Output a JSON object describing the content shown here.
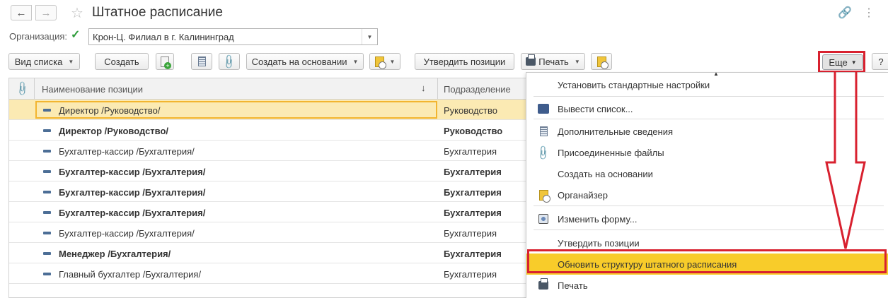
{
  "window": {
    "title": "Штатное расписание"
  },
  "org": {
    "label": "Организация:",
    "value": "Крон-Ц. Филиал в г. Калининград"
  },
  "toolbar": {
    "view_list": "Вид списка",
    "create": "Создать",
    "create_based": "Создать на основании",
    "approve": "Утвердить позиции",
    "print": "Печать",
    "more": "Еще",
    "help": "?"
  },
  "table": {
    "col_name": "Наименование позиции",
    "col_dept": "Подразделение",
    "rows": [
      {
        "name": "Директор /Руководство/",
        "dept": "Руководство",
        "bold": false,
        "selected": true
      },
      {
        "name": "Директор /Руководство/",
        "dept": "Руководство",
        "bold": true,
        "selected": false
      },
      {
        "name": "Бухгалтер-кассир /Бухгалтерия/",
        "dept": "Бухгалтерия",
        "bold": false,
        "selected": false
      },
      {
        "name": "Бухгалтер-кассир /Бухгалтерия/",
        "dept": "Бухгалтерия",
        "bold": true,
        "selected": false
      },
      {
        "name": "Бухгалтер-кассир /Бухгалтерия/",
        "dept": "Бухгалтерия",
        "bold": true,
        "selected": false
      },
      {
        "name": "Бухгалтер-кассир /Бухгалтерия/",
        "dept": "Бухгалтерия",
        "bold": true,
        "selected": false
      },
      {
        "name": "Бухгалтер-кассир /Бухгалтерия/",
        "dept": "Бухгалтерия",
        "bold": false,
        "selected": false
      },
      {
        "name": "Менеджер /Бухгалтерия/",
        "dept": "Бухгалтерия",
        "bold": true,
        "selected": false
      },
      {
        "name": "Главный бухгалтер /Бухгалтерия/",
        "dept": "Бухгалтерия",
        "bold": false,
        "selected": false
      }
    ]
  },
  "menu": {
    "items": [
      {
        "label": "Установить стандартные настройки",
        "icon": "none"
      },
      {
        "label": "Вывести список...",
        "icon": "export-icon"
      },
      {
        "label": "Дополнительные сведения",
        "icon": "list-icon"
      },
      {
        "label": "Присоединенные файлы",
        "icon": "paperclip-icon"
      },
      {
        "label": "Создать на основании",
        "icon": "none"
      },
      {
        "label": "Органайзер",
        "icon": "organizer-icon"
      },
      {
        "label": "Изменить форму...",
        "icon": "form-icon"
      },
      {
        "label": "Утвердить позиции",
        "icon": "none"
      },
      {
        "label": "Обновить структуру штатного расписания",
        "icon": "none",
        "highlighted": true
      },
      {
        "label": "Печать",
        "icon": "printer-icon"
      }
    ]
  },
  "colors": {
    "highlight": "#f8cc2a",
    "annotation": "#d8212f",
    "selected_row": "#fbeab3"
  }
}
